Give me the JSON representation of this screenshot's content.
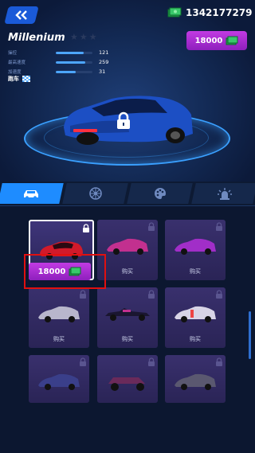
{
  "header": {
    "currency_value": "1342177279",
    "car_name": "Millenium",
    "price_label": "18000"
  },
  "stats": [
    {
      "label": "操控",
      "value": "121",
      "fill": 0.75
    },
    {
      "label": "最高速度",
      "value": "259",
      "fill": 0.8
    },
    {
      "label": "加速度",
      "value": "31",
      "fill": 0.55
    }
  ],
  "car_type_label": "跑车",
  "tabs": [
    "car-icon",
    "wheel-icon",
    "paint-icon",
    "lights-icon"
  ],
  "grid": {
    "selected_price": "18000",
    "buy_label": "购买"
  },
  "colors": {
    "accent": "#1e8cff",
    "price_purple": "#b130d8",
    "highlight": "#e01010"
  }
}
